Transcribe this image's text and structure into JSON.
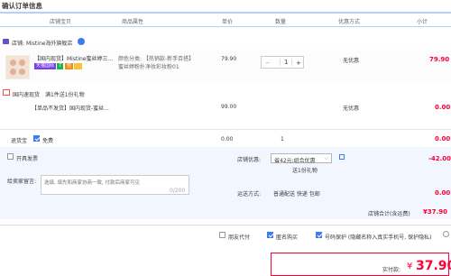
{
  "page": {
    "title": "确认订单信息"
  },
  "columns": [
    "店铺宝贝",
    "商品属性",
    "单价",
    "数量",
    "优惠方式",
    "小计"
  ],
  "shop": {
    "label_prefix": "店铺:",
    "name": "Mistine海外旗舰店"
  },
  "item": {
    "name": "【国内现货】Mistine蜜丝婷三...",
    "badges": [
      "天猫国际",
      "7",
      "包"
    ],
    "attr_line1": "颜色分类: 【热销款-新手百搭】",
    "attr_line2": "蜜丝婷粉扑净妆彩妆粉01",
    "price": "79.90",
    "qty": "1",
    "minus": "−",
    "plus": "+",
    "discount": "无优惠",
    "subtotal": "79.90"
  },
  "gift": {
    "header_prefix": "国内速现货",
    "header_rule": "满1件送1份礼物",
    "name": "【单品不发货】国内现货-蜜丝...",
    "price": "99.00",
    "discount": "无优惠",
    "subtotal": "0.00"
  },
  "return_row": {
    "label": "退货宝",
    "option": "免费",
    "price": "0.00",
    "qty": "1",
    "subtotal": "0.00"
  },
  "invoice": {
    "label": "开具发票"
  },
  "shop_discount": {
    "label": "店铺优惠:",
    "value": "省42元:组合优惠",
    "note": "送1份礼物",
    "amount": "-42.00"
  },
  "memo": {
    "label": "给卖家留言:",
    "placeholder": "选填, 填先和商家协商一致, 付款后商家可见",
    "counter": "0/200"
  },
  "shipping": {
    "label": "运送方式:",
    "value": "普通配送 快递 包邮",
    "amount": "0.00"
  },
  "shop_total": {
    "label": "店铺合计(含运费)",
    "amount": "¥37.90"
  },
  "options": [
    {
      "label": "朋友代付",
      "checked": false
    },
    {
      "label": "匿名购买",
      "checked": true
    },
    {
      "label": "号码保护 (隐藏名称入真实手机号, 保护隐私)",
      "checked": true
    }
  ],
  "payment": {
    "label": "实付款:",
    "currency": "¥",
    "amount": "37.90"
  },
  "colors": {
    "accent": "#ff0036",
    "brand": "#3a7df0",
    "header_border": "#b2d1ff"
  }
}
